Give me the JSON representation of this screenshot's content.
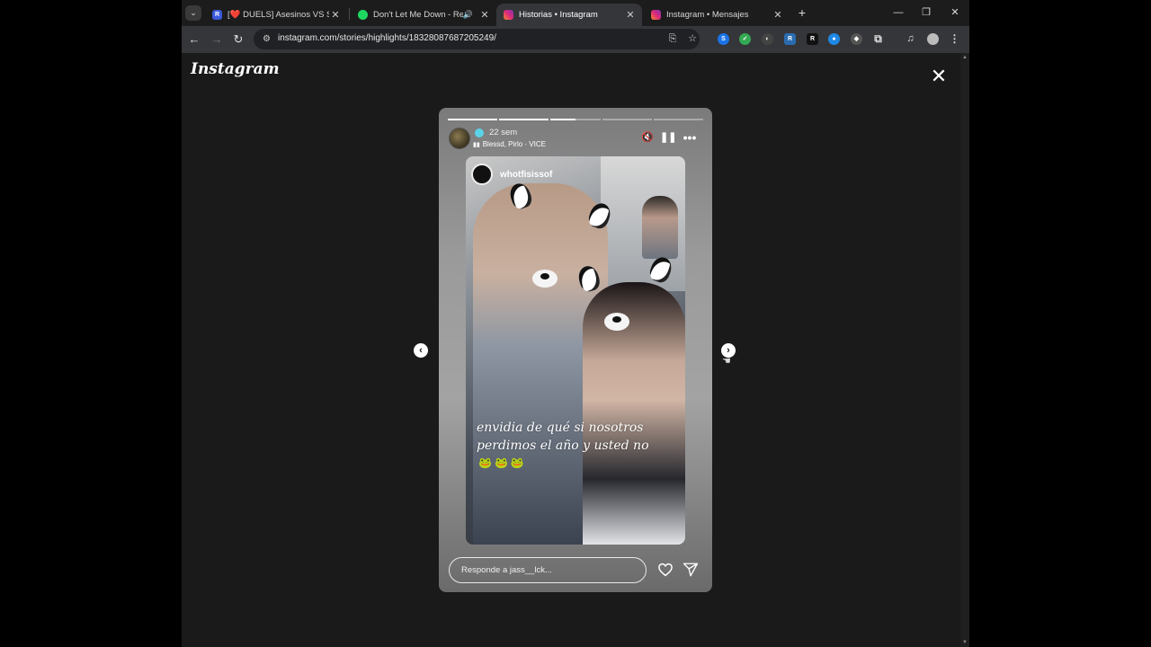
{
  "tabs": [
    {
      "title": "[❤️ DUELS] Asesinos VS Sheriffs",
      "favicon": "R",
      "favicon_color": "#3b5bdb",
      "active": false
    },
    {
      "title": "Don't Let Me Down - Remaster",
      "favicon": "",
      "favicon_color": "#1ed760",
      "active": false,
      "audio": true
    },
    {
      "title": "Historias • Instagram",
      "favicon": "",
      "favicon_color": "#e1306c",
      "active": true
    },
    {
      "title": "Instagram • Mensajes",
      "favicon": "",
      "favicon_color": "#e1306c",
      "active": false
    }
  ],
  "toolbar": {
    "url": "instagram.com/stories/highlights/18328087687205249/"
  },
  "extensions": [
    "S",
    "",
    "",
    "R",
    "R",
    "",
    "",
    ""
  ],
  "page": {
    "brand": "Instagram",
    "story": {
      "progress": [
        1,
        1,
        0.5,
        0,
        0
      ],
      "time": "22 sem",
      "music": "Blessd, Pirlo · VICE",
      "inner_username": "whotfisissof",
      "caption": "envidia de qué si nosotros perdimos el año y usted no",
      "emojis": "🐸🐸🐸",
      "reply_placeholder": "Responde a jass__lck..."
    }
  }
}
